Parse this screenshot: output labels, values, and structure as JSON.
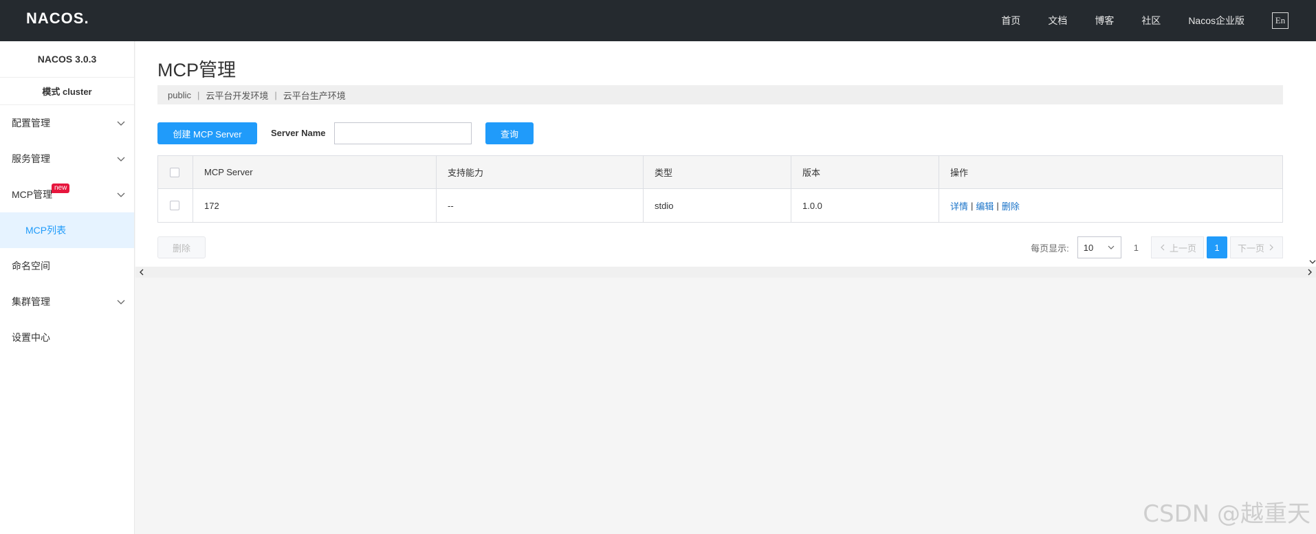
{
  "brand": {
    "logo": "NACOS."
  },
  "topnav": {
    "items": [
      "首页",
      "文档",
      "博客",
      "社区",
      "Nacos企业版"
    ],
    "lang": "En"
  },
  "sidebar": {
    "version": "NACOS 3.0.3",
    "mode": "模式  cluster",
    "items": [
      {
        "label": "配置管理",
        "expandable": true
      },
      {
        "label": "服务管理",
        "expandable": true
      },
      {
        "label": "MCP管理",
        "expandable": true,
        "badge": "new"
      },
      {
        "label": "MCP列表",
        "sub": true,
        "active": true
      },
      {
        "label": "命名空间",
        "expandable": false
      },
      {
        "label": "集群管理",
        "expandable": true
      },
      {
        "label": "设置中心",
        "expandable": false
      }
    ]
  },
  "main": {
    "title": "MCP管理",
    "namespaces": [
      "public",
      "云平台开发环境",
      "云平台生产环境"
    ],
    "create_button": "创建 MCP Server",
    "search_label": "Server Name",
    "search_value": "",
    "query_button": "查询",
    "table": {
      "headers": [
        "MCP Server",
        "支持能力",
        "类型",
        "版本",
        "操作"
      ],
      "rows": [
        {
          "name": "172",
          "capability": "--",
          "type": "stdio",
          "version": "1.0.0",
          "ops": [
            "详情",
            "编辑",
            "删除"
          ]
        }
      ]
    },
    "delete_button": "删除",
    "pager": {
      "page_size_label": "每页显示:",
      "page_size": "10",
      "total": "1",
      "prev": "上一页",
      "current": "1",
      "next": "下一页"
    }
  },
  "watermark": "CSDN @越重天",
  "colors": {
    "primary": "#209bfa",
    "topbar": "#252a2f",
    "badge": "#e6163d",
    "link": "#1a73c8"
  }
}
